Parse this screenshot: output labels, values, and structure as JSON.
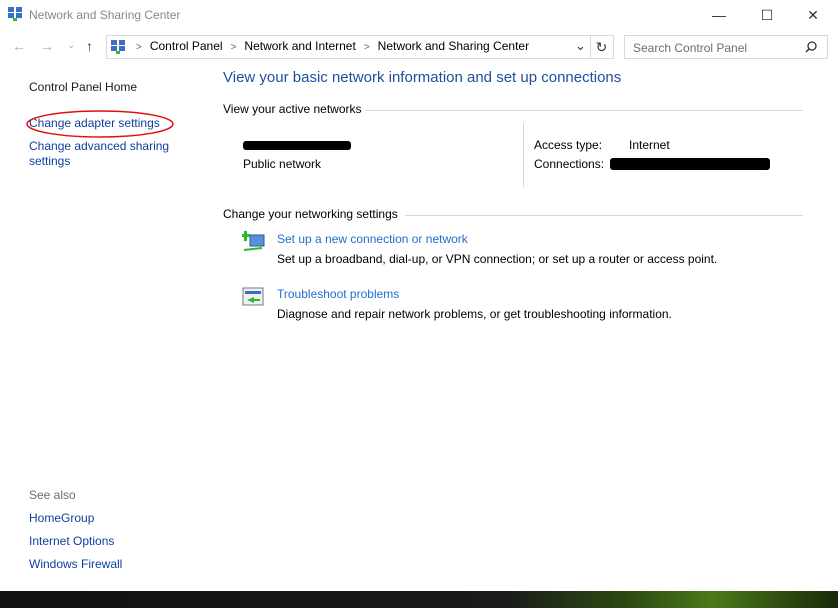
{
  "window": {
    "title": "Network and Sharing Center",
    "minimize": "—",
    "maximize": "☐",
    "close": "✕"
  },
  "nav": {
    "back": "←",
    "forward": "→",
    "recent": "⌄",
    "up": "↑"
  },
  "address": {
    "crumbs": [
      "Control Panel",
      "Network and Internet",
      "Network and Sharing Center"
    ],
    "dropdown": "⌄",
    "refresh": "↻"
  },
  "search": {
    "placeholder": "Search Control Panel",
    "icon": "search-icon"
  },
  "sidebar": {
    "items": [
      "Control Panel Home",
      "Change adapter settings",
      "Change advanced sharing settings"
    ],
    "see_also": "See also",
    "see_also_items": [
      "HomeGroup",
      "Internet Options",
      "Windows Firewall"
    ]
  },
  "main": {
    "heading": "View your basic network information and set up connections",
    "active_networks": "View your active networks",
    "network_type": "Public network",
    "access_type_label": "Access type:",
    "access_type_value": "Internet",
    "connections_label": "Connections:",
    "change_settings": "Change your networking settings",
    "tasks": [
      {
        "title": "Set up a new connection or network",
        "desc": "Set up a broadband, dial-up, or VPN connection; or set up a router or access point."
      },
      {
        "title": "Troubleshoot problems",
        "desc": "Diagnose and repair network problems, or get troubleshooting information."
      }
    ]
  },
  "annotation_color": "#e01010"
}
